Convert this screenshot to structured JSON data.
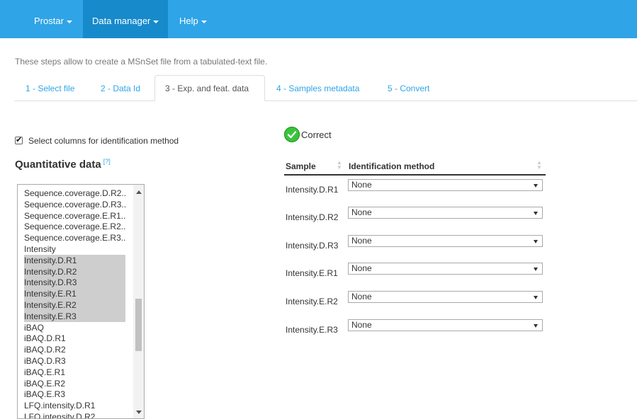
{
  "navbar": {
    "items": [
      {
        "label": "Prostar",
        "active": false
      },
      {
        "label": "Data manager",
        "active": true
      },
      {
        "label": "Help",
        "active": false
      }
    ]
  },
  "intro_text": "These steps allow to create a MSnSet file from a tabulated-text file.",
  "tabs": [
    {
      "label": "1 - Select file",
      "active": false
    },
    {
      "label": "2 - Data Id",
      "active": false
    },
    {
      "label": "3 - Exp. and feat. data",
      "active": true
    },
    {
      "label": "4 - Samples metadata",
      "active": false
    },
    {
      "label": "5 - Convert",
      "active": false
    }
  ],
  "checkbox": {
    "label": "Select columns for identification method",
    "checked": true
  },
  "quantitative": {
    "title": "Quantitative data",
    "help": "[?]",
    "items": [
      {
        "label": "Sequence.coverage.D.R2...",
        "selected": false
      },
      {
        "label": "Sequence.coverage.D.R3...",
        "selected": false
      },
      {
        "label": "Sequence.coverage.E.R1...",
        "selected": false
      },
      {
        "label": "Sequence.coverage.E.R2...",
        "selected": false
      },
      {
        "label": "Sequence.coverage.E.R3...",
        "selected": false
      },
      {
        "label": "Intensity",
        "selected": false
      },
      {
        "label": "Intensity.D.R1",
        "selected": true
      },
      {
        "label": "Intensity.D.R2",
        "selected": true
      },
      {
        "label": "Intensity.D.R3",
        "selected": true
      },
      {
        "label": "Intensity.E.R1",
        "selected": true
      },
      {
        "label": "Intensity.E.R2",
        "selected": true
      },
      {
        "label": "Intensity.E.R3",
        "selected": true
      },
      {
        "label": "iBAQ",
        "selected": false
      },
      {
        "label": "iBAQ.D.R1",
        "selected": false
      },
      {
        "label": "iBAQ.D.R2",
        "selected": false
      },
      {
        "label": "iBAQ.D.R3",
        "selected": false
      },
      {
        "label": "iBAQ.E.R1",
        "selected": false
      },
      {
        "label": "iBAQ.E.R2",
        "selected": false
      },
      {
        "label": "iBAQ.E.R3",
        "selected": false
      },
      {
        "label": "LFQ.intensity.D.R1",
        "selected": false
      },
      {
        "label": "LFQ.intensity.D.R2",
        "selected": false
      }
    ]
  },
  "status": {
    "text": "Correct",
    "color": "#3ac43a"
  },
  "table": {
    "headers": [
      "Sample",
      "Identification method"
    ],
    "rows": [
      {
        "sample": "Intensity.D.R1",
        "method": "None"
      },
      {
        "sample": "Intensity.D.R2",
        "method": "None"
      },
      {
        "sample": "Intensity.D.R3",
        "method": "None"
      },
      {
        "sample": "Intensity.E.R1",
        "method": "None"
      },
      {
        "sample": "Intensity.E.R2",
        "method": "None"
      },
      {
        "sample": "Intensity.E.R3",
        "method": "None"
      }
    ]
  },
  "colors": {
    "navbar": "#2fa4e7",
    "navbar_active": "#178acc",
    "link": "#2fa4e7",
    "selection": "#cecece"
  }
}
